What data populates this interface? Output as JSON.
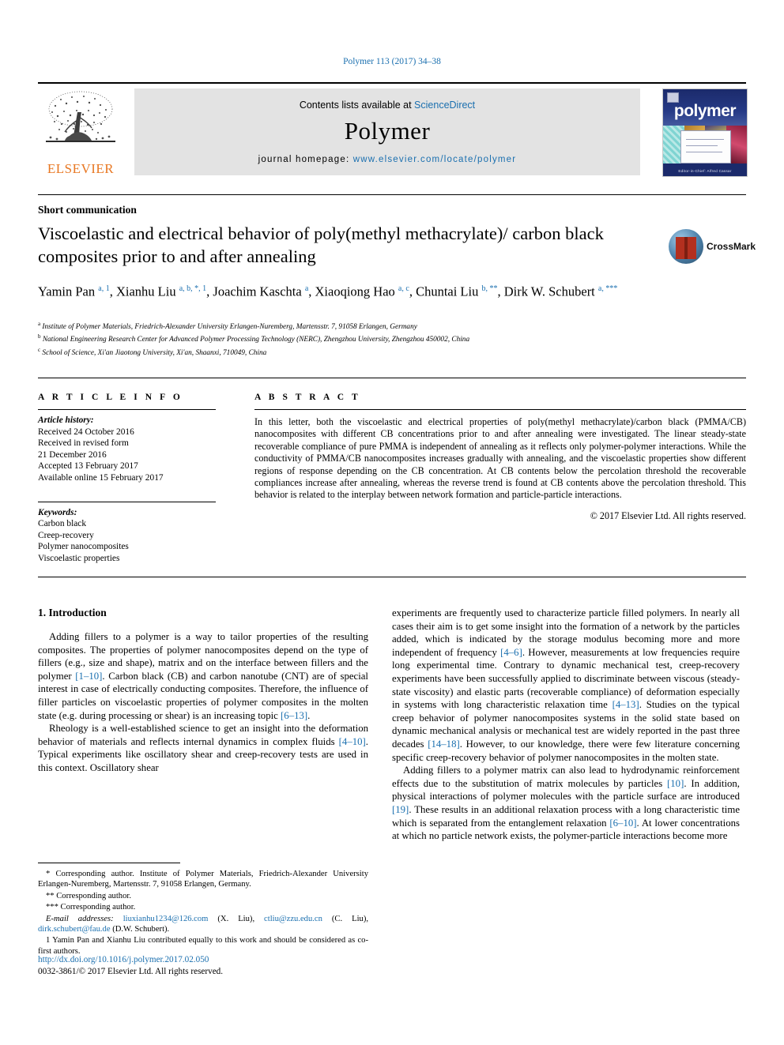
{
  "running_head": "Polymer 113 (2017) 34–38",
  "masthead": {
    "publisher": "ELSEVIER",
    "contents_prefix": "Contents lists available at ",
    "contents_link": "ScienceDirect",
    "journal_title": "Polymer",
    "homepage_label": "journal homepage: ",
    "homepage_url": "www.elsevier.com/locate/polymer",
    "cover_word": "polymer",
    "cover_footer": "Editor-in-Chief: Alfred Cassar"
  },
  "article": {
    "type": "Short communication",
    "title": "Viscoelastic and electrical behavior of poly(methyl methacrylate)/ carbon black composites prior to and after annealing",
    "crossmark_label": "CrossMark",
    "authors_html": "Yamin Pan <sup>a, 1</sup>, Xianhu Liu <sup>a, b, *, 1</sup>, Joachim Kaschta <sup>a</sup>, Xiaoqiong Hao <sup>a, c</sup>, Chuntai Liu <sup>b, **</sup>, Dirk W. Schubert <sup>a, ***</sup>",
    "affiliations": [
      "Institute of Polymer Materials, Friedrich-Alexander University Erlangen-Nuremberg, Martensstr. 7, 91058 Erlangen, Germany",
      "National Engineering Research Center for Advanced Polymer Processing Technology (NERC), Zhengzhou University, Zhengzhou 450002, China",
      "School of Science, Xi'an Jiaotong University, Xi'an, Shaanxi, 710049, China"
    ],
    "affiliation_marks": [
      "a",
      "b",
      "c"
    ]
  },
  "info": {
    "heading": "A R T I C L E   I N F O",
    "history_label": "Article history:",
    "history": [
      "Received 24 October 2016",
      "Received in revised form",
      "21 December 2016",
      "Accepted 13 February 2017",
      "Available online 15 February 2017"
    ],
    "keywords_label": "Keywords:",
    "keywords": [
      "Carbon black",
      "Creep-recovery",
      "Polymer nanocomposites",
      "Viscoelastic properties"
    ]
  },
  "abstract": {
    "heading": "A B S T R A C T",
    "text": "In this letter, both the viscoelastic and electrical properties of poly(methyl methacrylate)/carbon black (PMMA/CB) nanocomposites with different CB concentrations prior to and after annealing were investigated. The linear steady-state recoverable compliance of pure PMMA is independent of annealing as it reflects only polymer-polymer interactions. While the conductivity of PMMA/CB nanocomposites increases gradually with annealing, and the viscoelastic properties show different regions of response depending on the CB concentration. At CB contents below the percolation threshold the recoverable compliances increase after annealing, whereas the reverse trend is found at CB contents above the percolation threshold. This behavior is related to the interplay between network formation and particle-particle interactions.",
    "rights": "© 2017 Elsevier Ltd. All rights reserved."
  },
  "body": {
    "section_heading": "1. Introduction",
    "left_paragraphs": [
      "Adding fillers to a polymer is a way to tailor properties of the resulting composites. The properties of polymer nanocomposites depend on the type of fillers (e.g., size and shape), matrix and on the interface between fillers and the polymer [1–10]. Carbon black (CB) and carbon nanotube (CNT) are of special interest in case of electrically conducting composites. Therefore, the influence of filler particles on viscoelastic properties of polymer composites in the molten state (e.g. during processing or shear) is an increasing topic [6–13].",
      "Rheology is a well-established science to get an insight into the deformation behavior of materials and reflects internal dynamics in complex fluids [4–10]. Typical experiments like oscillatory shear and creep-recovery tests are used in this context. Oscillatory shear"
    ],
    "right_paragraphs": [
      "experiments are frequently used to characterize particle filled polymers. In nearly all cases their aim is to get some insight into the formation of a network by the particles added, which is indicated by the storage modulus becoming more and more independent of frequency [4–6]. However, measurements at low frequencies require long experimental time. Contrary to dynamic mechanical test, creep-recovery experiments have been successfully applied to discriminate between viscous (steady-state viscosity) and elastic parts (recoverable compliance) of deformation especially in systems with long characteristic relaxation time [4–13]. Studies on the typical creep behavior of polymer nanocomposites systems in the solid state based on dynamic mechanical analysis or mechanical test are widely reported in the past three decades [14–18]. However, to our knowledge, there were few literature concerning specific creep-recovery behavior of polymer nanocomposites in the molten state.",
      "Adding fillers to a polymer matrix can also lead to hydrodynamic reinforcement effects due to the substitution of matrix molecules by particles [10]. In addition, physical interactions of polymer molecules with the particle surface are introduced [19]. These results in an additional relaxation process with a long characteristic time which is separated from the entanglement relaxation [6–10]. At lower concentrations at which no particle network exists, the polymer-particle interactions become more"
    ]
  },
  "footnotes": {
    "corresponding_1": "* Corresponding author. Institute of Polymer Materials, Friedrich-Alexander University Erlangen-Nuremberg, Martensstr. 7, 91058 Erlangen, Germany.",
    "corresponding_2": "** Corresponding author.",
    "corresponding_3": "*** Corresponding author.",
    "email_label": "E-mail addresses:",
    "emails": [
      {
        "address": "liuxianhu1234@126.com",
        "owner": "(X. Liu)"
      },
      {
        "address": "ctliu@zzu.edu.cn",
        "owner": "(C. Liu)"
      },
      {
        "address": "dirk.schubert@fau.de",
        "owner": "(D.W. Schubert)."
      }
    ],
    "equal_contribution": "1 Yamin Pan and Xianhu Liu contributed equally to this work and should be considered as co-first authors."
  },
  "doi_block": {
    "doi": "http://dx.doi.org/10.1016/j.polymer.2017.02.050",
    "issn_rights": "0032-3861/© 2017 Elsevier Ltd. All rights reserved."
  }
}
